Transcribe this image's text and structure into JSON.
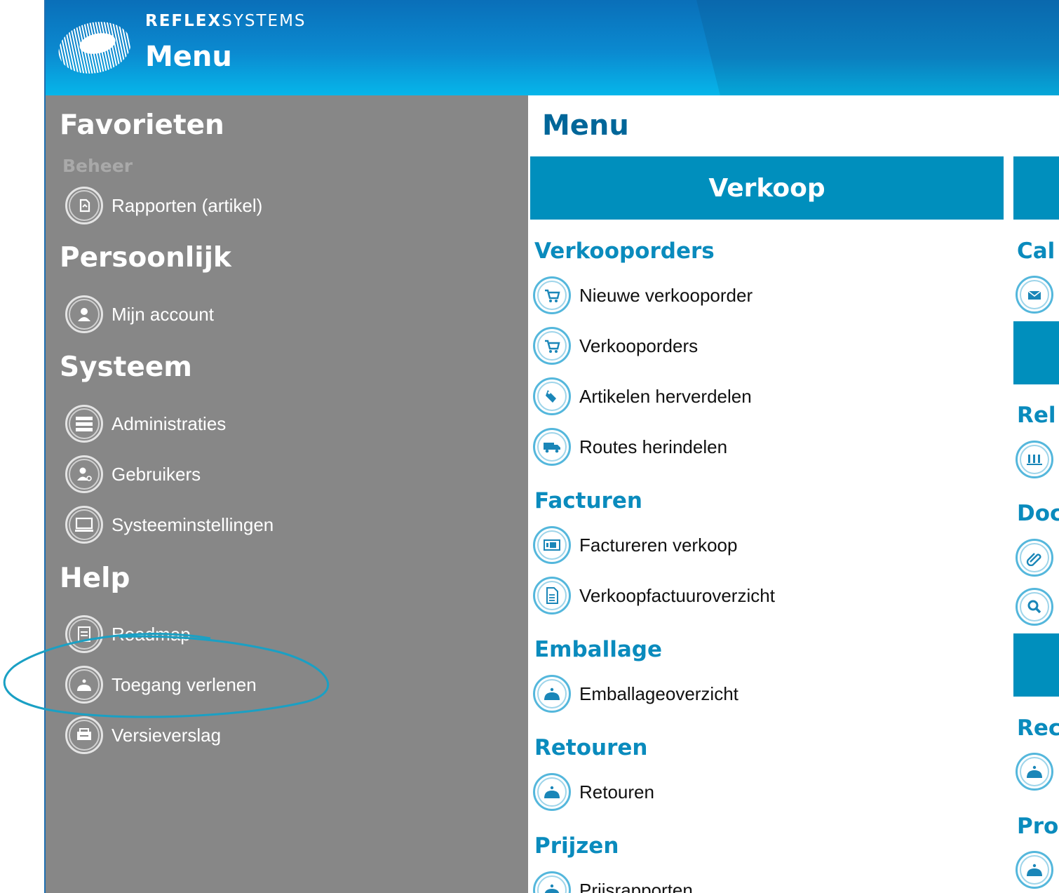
{
  "header": {
    "brand_bold": "REFLEX",
    "brand_light": "SYSTEMS",
    "title": "Menu"
  },
  "sidebar": {
    "sections": [
      {
        "heading": "Favorieten",
        "sub": "Beheer",
        "items": [
          {
            "label": "Rapporten (artikel)",
            "icon": "report-icon"
          }
        ]
      },
      {
        "heading": "Persoonlijk",
        "items": [
          {
            "label": "Mijn account",
            "icon": "user-icon"
          }
        ]
      },
      {
        "heading": "Systeem",
        "items": [
          {
            "label": "Administraties",
            "icon": "list-icon"
          },
          {
            "label": "Gebruikers",
            "icon": "users-icon"
          },
          {
            "label": "Systeeminstellingen",
            "icon": "monitor-icon"
          }
        ]
      },
      {
        "heading": "Help",
        "items": [
          {
            "label": "Roadmap",
            "icon": "roadmap-icon"
          },
          {
            "label": "Toegang verlenen",
            "icon": "access-icon"
          },
          {
            "label": "Versieverslag",
            "icon": "version-icon"
          }
        ]
      }
    ]
  },
  "main": {
    "title": "Menu",
    "column1": {
      "banner": "Verkoop",
      "sections": [
        {
          "heading": "Verkooporders",
          "items": [
            {
              "label": "Nieuwe verkooporder",
              "icon": "cart-icon"
            },
            {
              "label": "Verkooporders",
              "icon": "cart-icon"
            },
            {
              "label": "Artikelen herverdelen",
              "icon": "tag-icon"
            },
            {
              "label": "Routes herindelen",
              "icon": "truck-icon"
            }
          ]
        },
        {
          "heading": "Facturen",
          "items": [
            {
              "label": "Factureren verkoop",
              "icon": "invoice-icon"
            },
            {
              "label": "Verkoopfactuuroverzicht",
              "icon": "document-icon"
            }
          ]
        },
        {
          "heading": "Emballage",
          "items": [
            {
              "label": "Emballageoverzicht",
              "icon": "bell-icon"
            }
          ]
        },
        {
          "heading": "Retouren",
          "items": [
            {
              "label": "Retouren",
              "icon": "bell-icon"
            }
          ]
        },
        {
          "heading": "Prijzen",
          "items": [
            {
              "label": "Prijsrapporten",
              "icon": "bell-icon"
            }
          ]
        }
      ]
    },
    "column2_partial": {
      "headings": [
        "Cal",
        "Rel",
        "Doc",
        "Rec",
        "Pro"
      ]
    }
  },
  "colors": {
    "header_blue": "#0b8ad0",
    "sidebar_gray": "#878787",
    "banner_blue": "#008fbd",
    "section_blue": "#0a8bbd",
    "annotation": "#1aa0c4"
  }
}
